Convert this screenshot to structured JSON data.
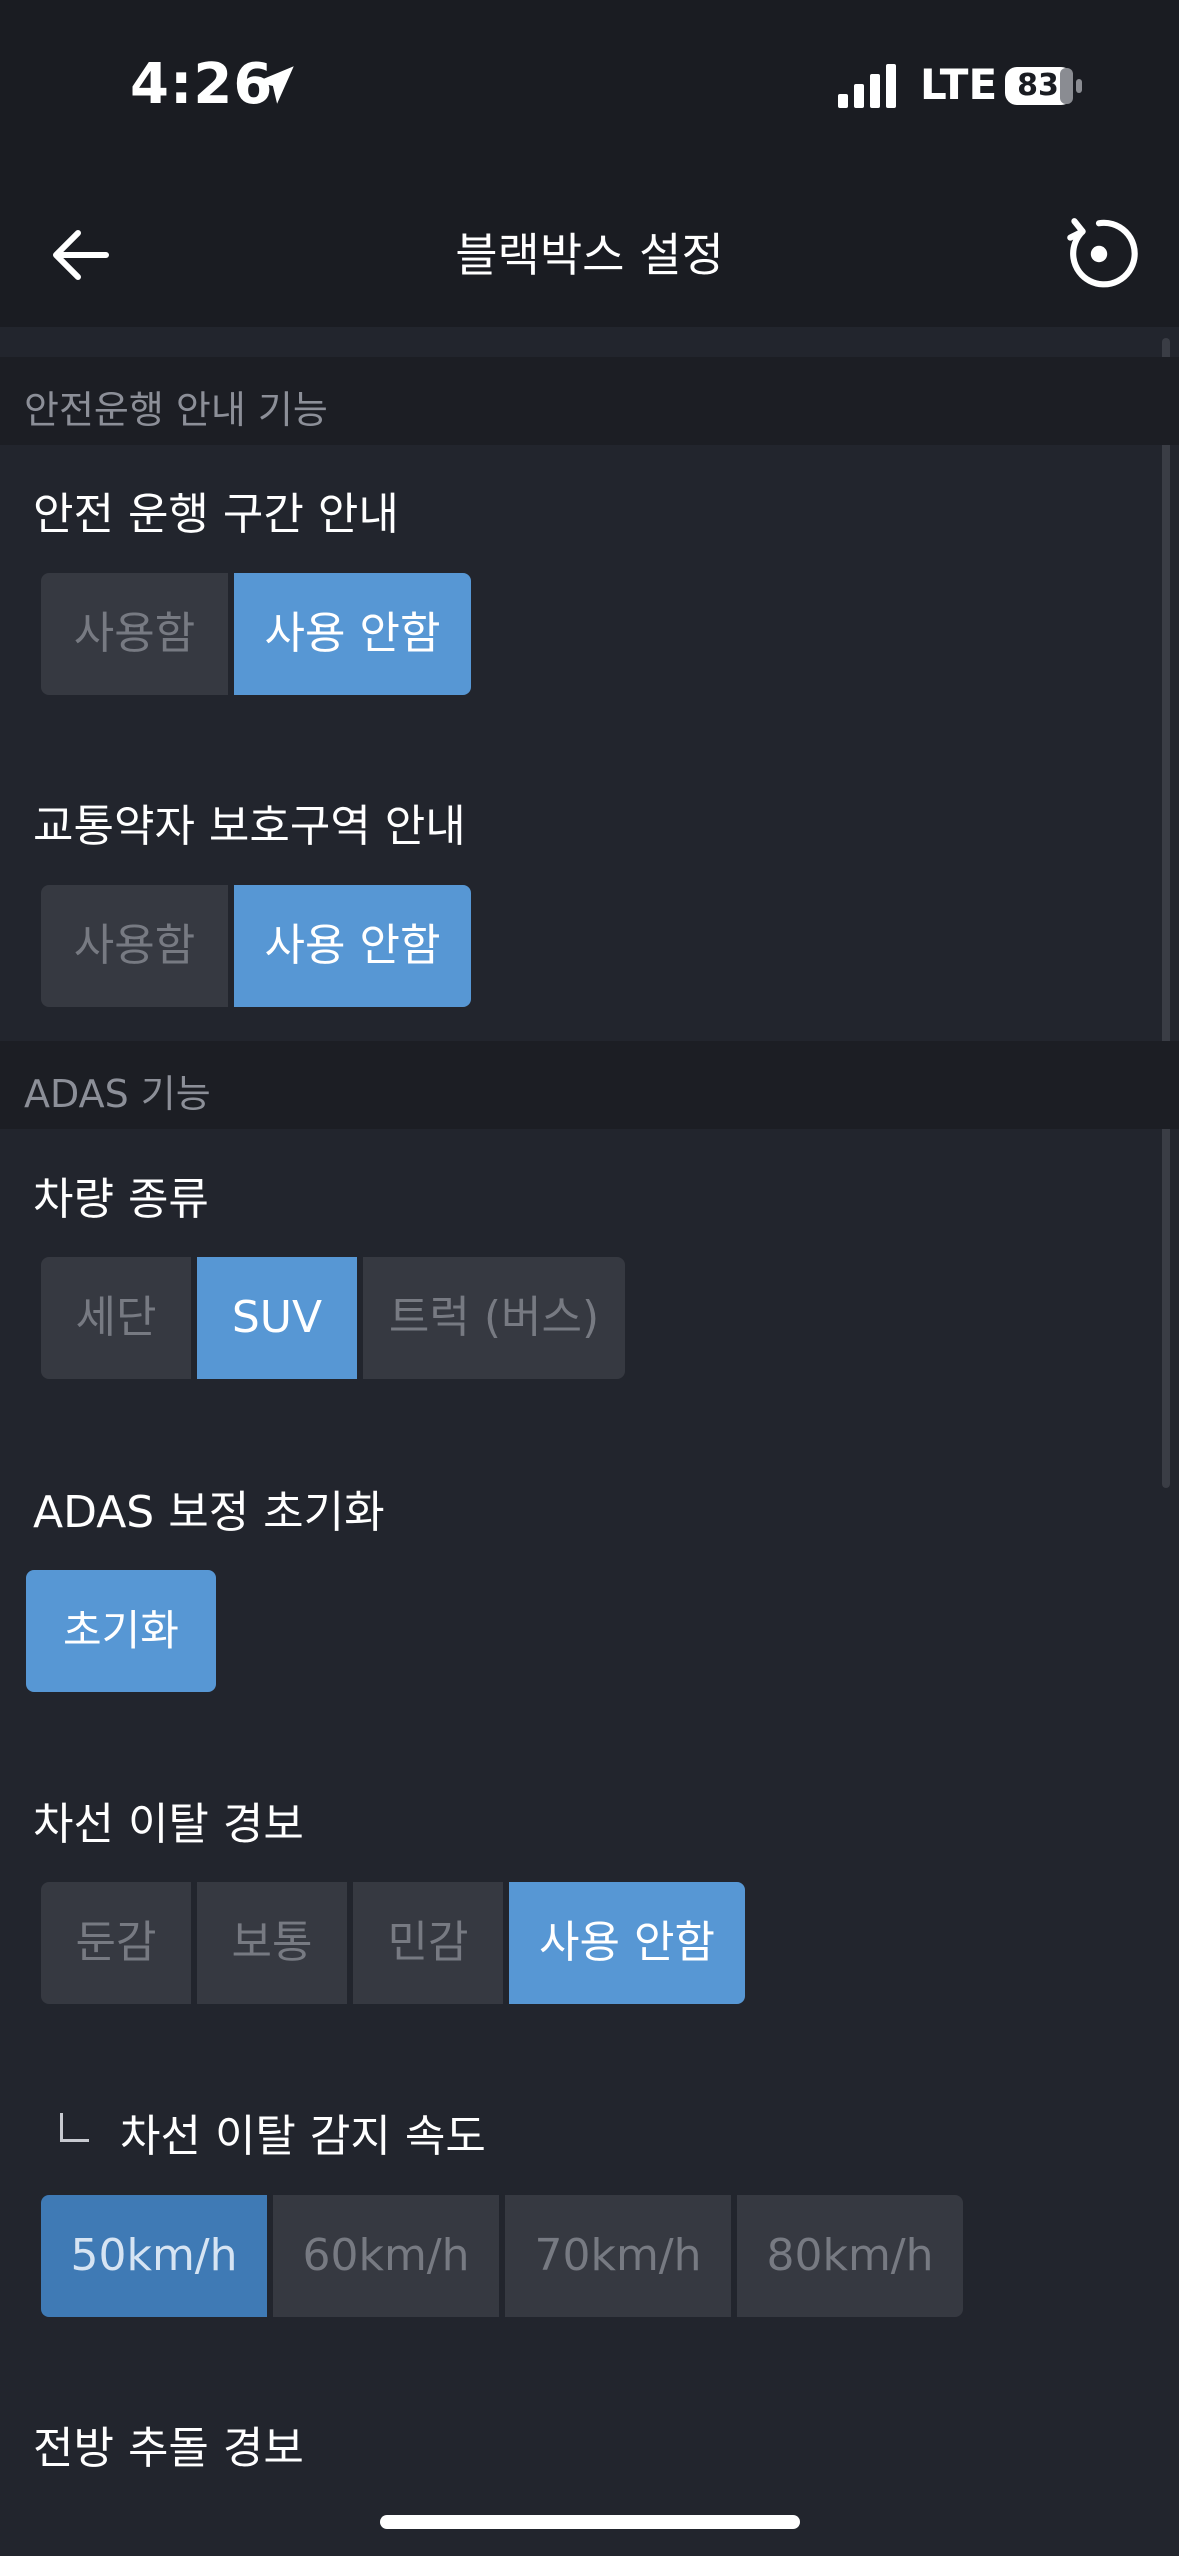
{
  "status": {
    "time": "4:26",
    "network": "LTE",
    "battery": "83"
  },
  "nav": {
    "title": "블랙박스 설정",
    "back_icon": "arrow-left-icon",
    "reset_icon": "refresh-icon"
  },
  "sections": [
    {
      "header": "안전운행 안내 기능"
    },
    {
      "header": "ADAS 기능"
    }
  ],
  "safe_zone": {
    "label": "안전 운행 구간 안내",
    "options": [
      "사용함",
      "사용 안함"
    ],
    "selected": "사용 안함"
  },
  "protect_zone": {
    "label": "교통약자 보호구역 안내",
    "options": [
      "사용함",
      "사용 안함"
    ],
    "selected": "사용 안함"
  },
  "vehicle_type": {
    "label": "차량 종류",
    "options": [
      "세단",
      "SUV",
      "트럭 (버스)"
    ],
    "selected": "SUV"
  },
  "adas_reset": {
    "label": "ADAS 보정 초기화",
    "button": "초기화"
  },
  "lane_departure": {
    "label": "차선 이탈 경보",
    "options": [
      "둔감",
      "보통",
      "민감",
      "사용 안함"
    ],
    "selected": "사용 안함"
  },
  "lane_speed": {
    "label": "차선 이탈 감지 속도",
    "options": [
      "50km/h",
      "60km/h",
      "70km/h",
      "80km/h"
    ],
    "selected": "50km/h"
  },
  "forward_collision": {
    "label": "전방 추돌 경보"
  },
  "colors": {
    "accent": "#5797d4",
    "background": "#22252d",
    "header_bg": "#1a1c22"
  }
}
